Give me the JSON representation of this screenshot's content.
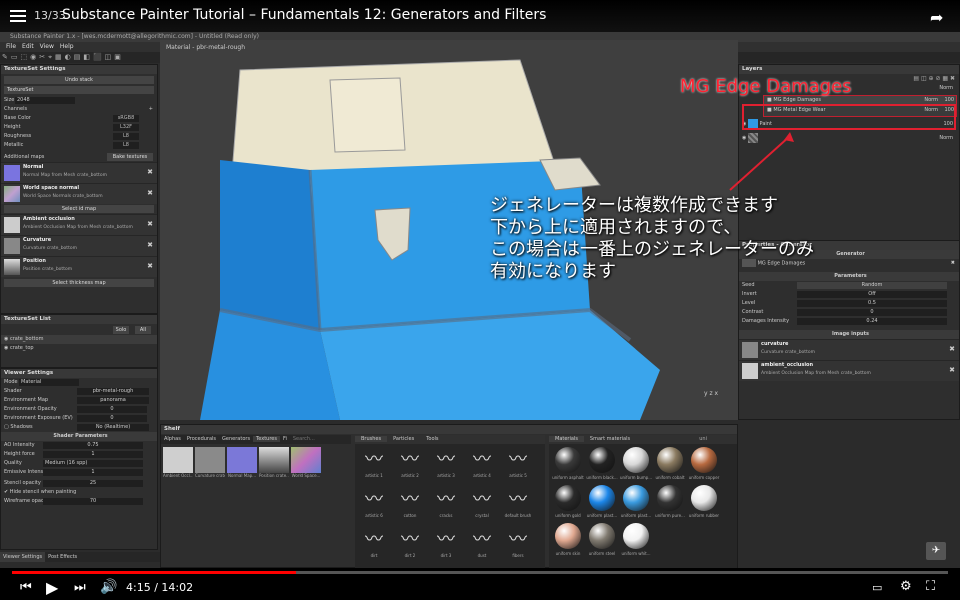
{
  "youtube": {
    "playlist_count": "13/33",
    "video_title": "Substance Painter Tutorial – Fundamentals 12: Generators and Filters",
    "time": "4:15 / 14:02",
    "progress_fraction": 0.303
  },
  "app": {
    "window_title": "Substance Painter 1.x - [wes.mcdermott@allegorithmic.com] - Untitled (Read only)",
    "menu": [
      "File",
      "Edit",
      "View",
      "Help"
    ]
  },
  "texture_set_settings": {
    "title": "TextureSet Settings",
    "undo_stack": "Undo stack",
    "textureset_label": "TextureSet",
    "size_label": "Size",
    "size_value": "2048",
    "channels_label": "Channels",
    "channels": [
      {
        "name": "Base Color",
        "format": "sRGB8"
      },
      {
        "name": "Height",
        "format": "L32F"
      },
      {
        "name": "Roughness",
        "format": "L8"
      },
      {
        "name": "Metallic",
        "format": "L8"
      }
    ],
    "additional_maps": "Additional maps",
    "bake_button": "Bake textures",
    "maps": [
      {
        "name": "Normal",
        "desc": "Normal Map from Mesh crate_bottom",
        "color": "#7a74e0"
      },
      {
        "name": "World space normal",
        "desc": "World Space Normals crate_bottom",
        "color": "#88b080"
      },
      {
        "name": "Select id map",
        "desc": "",
        "color": ""
      },
      {
        "name": "Ambient occlusion",
        "desc": "Ambient Occlusion Map from Mesh crate_bottom",
        "color": "#bbbbbb"
      },
      {
        "name": "Curvature",
        "desc": "Curvature crate_bottom",
        "color": "#888888"
      },
      {
        "name": "Position",
        "desc": "Position crate_bottom",
        "color": "#999999"
      }
    ],
    "thickness_button": "Select thickness map"
  },
  "textureset_list": {
    "title": "TextureSet List",
    "solo": "Solo",
    "all": "All",
    "items": [
      "crate_bottom",
      "crate_top"
    ]
  },
  "viewer_settings": {
    "title": "Viewer Settings",
    "mode_label": "Mode",
    "mode_value": "Material",
    "rows": [
      {
        "label": "Shader",
        "value": "pbr-metal-rough"
      },
      {
        "label": "Environment Map",
        "value": "panorama"
      },
      {
        "label": "Environment Opacity",
        "value": "0"
      },
      {
        "label": "Environment Exposure (EV)",
        "value": "0"
      },
      {
        "label": "Shadows",
        "value": "No (Realtime)"
      }
    ],
    "shader_params": "Shader Parameters",
    "params": [
      {
        "label": "AO Intensity",
        "value": "0.75"
      },
      {
        "label": "Height force",
        "value": "1"
      },
      {
        "label": "Quality",
        "value": "Medium (16 spp)"
      },
      {
        "label": "Emissive Intensity",
        "value": "1"
      }
    ],
    "stencil_opacity": "Stencil opacity",
    "stencil_value": "25",
    "hide_stencil": "Hide stencil when painting",
    "wireframe": "Wireframe opacity",
    "wireframe_value": "70",
    "tab1": "Viewer Settings",
    "tab2": "Post Effects"
  },
  "viewport": {
    "label": "Material - pbr-metal-rough",
    "axis": "y z x",
    "crate_blue": "#2e9be6"
  },
  "layers": {
    "title": "Layers",
    "mode": "Norm",
    "items": [
      {
        "name": "MG Edge Damages",
        "blend": "Norm",
        "opacity": "100"
      },
      {
        "name": "MG Metal Edge Wear",
        "blend": "Norm",
        "opacity": "100"
      },
      {
        "name": "Paint",
        "blend": "Norm",
        "opacity": "100"
      },
      {
        "name": "",
        "blend": "Norm",
        "opacity": ""
      }
    ]
  },
  "properties": {
    "title": "Properties - Generator",
    "generator_label": "Generator",
    "generator_value": "MG Edge Damages",
    "parameters_header": "Parameters",
    "params": [
      {
        "label": "Seed",
        "value": "Random"
      },
      {
        "label": "Invert",
        "value": "Off"
      },
      {
        "label": "Level",
        "value": "0.5"
      },
      {
        "label": "Contrast",
        "value": "0"
      },
      {
        "label": "Damages Intensity",
        "value": "0.24"
      }
    ],
    "image_inputs": "Image inputs",
    "inputs": [
      {
        "name": "curvature",
        "desc": "Curvature crate_bottom"
      },
      {
        "name": "ambient_occlusion",
        "desc": "Ambient Occlusion Map from Mesh crate_bottom"
      }
    ]
  },
  "shelf": {
    "title": "Shelf",
    "tabs": [
      "Alphas",
      "Procedurals",
      "Generators",
      "Textures",
      "Fi"
    ],
    "search": "Search...",
    "textures": [
      {
        "label": "Ambient Occl...",
        "color": "#cfcfcf"
      },
      {
        "label": "Curvature crate...",
        "color": "#8a8a8a"
      },
      {
        "label": "Normal Map...",
        "color": "#7b78d8"
      },
      {
        "label": "Position crate...",
        "color": "#aaaaaa"
      },
      {
        "label": "World Space...",
        "color": "#a0c070"
      }
    ],
    "brush_tabs": [
      "Brushes",
      "Particles",
      "Tools"
    ],
    "brushes": [
      "artistic 1",
      "artistic 2",
      "artistic 3",
      "artistic 4",
      "artistic 5",
      "artistic 6",
      "cotton",
      "cracks",
      "crystal",
      "default brush",
      "dirt",
      "dirt 2",
      "dirt 3",
      "dust",
      "fibers"
    ],
    "material_tabs": [
      "Materials",
      "Smart materials"
    ],
    "material_search": "uni",
    "materials": [
      {
        "label": "uniform asphalt",
        "color": "#3a3a3a"
      },
      {
        "label": "uniform black...",
        "color": "#222222"
      },
      {
        "label": "uniform bump...",
        "color": "#d8d8d8"
      },
      {
        "label": "uniform cobalt",
        "color": "#8a7a60"
      },
      {
        "label": "uniform copper",
        "color": "#b86a40"
      },
      {
        "label": "uniform gold",
        "color": "#2a2a2a"
      },
      {
        "label": "uniform plast...",
        "color": "#1c86e8"
      },
      {
        "label": "uniform plast...",
        "color": "#3a9be0"
      },
      {
        "label": "uniform pure...",
        "color": "#333333"
      },
      {
        "label": "uniform rubber",
        "color": "#e8e8e8"
      },
      {
        "label": "uniform skin",
        "color": "#e0a890"
      },
      {
        "label": "uniform steel",
        "color": "#807a70"
      },
      {
        "label": "uniform whit...",
        "color": "#f2f2f2"
      }
    ]
  },
  "annotations": {
    "title": "MG Edge Damages",
    "lines": [
      "ジェネレーターは複数作成できます",
      "下から上に適用されますので、",
      "この場合は一番上のジェネレーターのみ",
      "有効になります"
    ]
  }
}
